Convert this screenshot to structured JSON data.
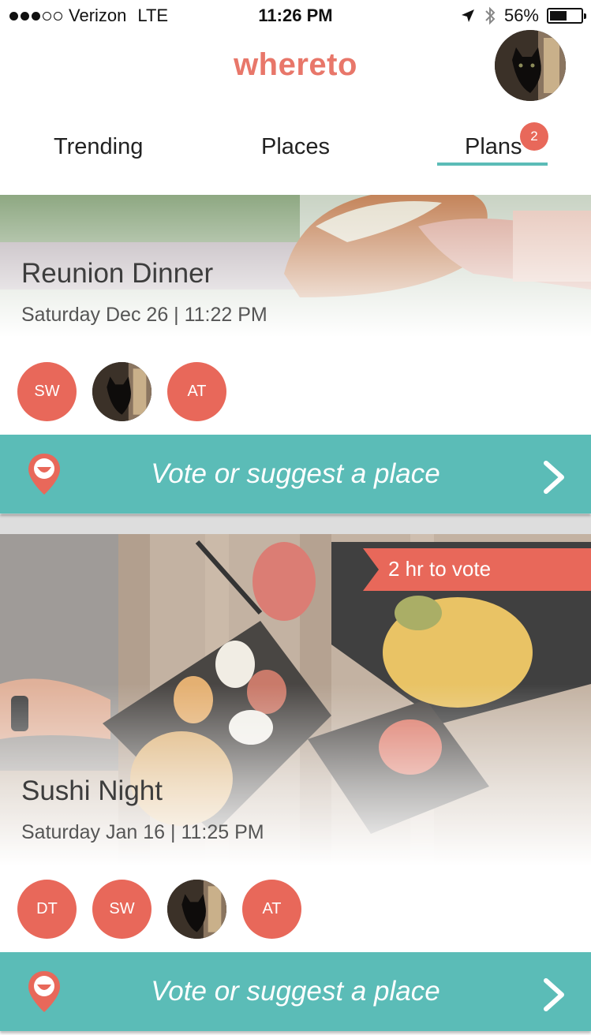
{
  "status_bar": {
    "carrier": "Verizon",
    "network": "LTE",
    "time": "11:26 PM",
    "battery": "56%",
    "battery_level": 0.56,
    "signal_bars_filled": 3,
    "signal_bars_total": 5
  },
  "app": {
    "title": "whereto",
    "accent_color": "#e8776a",
    "teal_color": "#5bbcb7"
  },
  "tabs": [
    {
      "label": "Trending",
      "active": false
    },
    {
      "label": "Places",
      "active": false
    },
    {
      "label": "Plans",
      "active": true,
      "badge": "2"
    }
  ],
  "plans": [
    {
      "title": "Reunion Dinner",
      "datetime": "Saturday Dec 26 | 11:22 PM",
      "attendees": [
        {
          "initials": "SW",
          "photo": false
        },
        {
          "initials": "",
          "photo": true,
          "icon": "cat-avatar"
        },
        {
          "initials": "AT",
          "photo": false
        }
      ],
      "action": "Vote or suggest a place"
    },
    {
      "title": "Sushi Night",
      "datetime": "Saturday Jan 16 | 11:25 PM",
      "ribbon": "2 hr to vote",
      "attendees": [
        {
          "initials": "DT",
          "photo": false
        },
        {
          "initials": "SW",
          "photo": false
        },
        {
          "initials": "",
          "photo": true,
          "icon": "cat-avatar"
        },
        {
          "initials": "AT",
          "photo": false
        }
      ],
      "action": "Vote or suggest a place"
    }
  ]
}
